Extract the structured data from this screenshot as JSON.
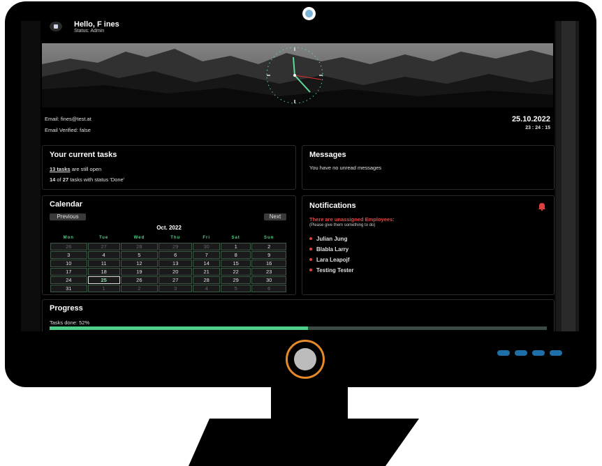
{
  "header": {
    "greeting": "Hello, F ines",
    "status": "Status: Admin"
  },
  "account": {
    "email": "Email: fines@test.at",
    "verified": "Email Verified: false",
    "date": "25.10.2022",
    "time": "23 : 24 : 15"
  },
  "tasks": {
    "title": "Your current tasks",
    "open_link": "13 tasks",
    "open_suffix": " are still open",
    "done_a": "14",
    "done_of": " of ",
    "done_b": "27",
    "done_suffix": " tasks with status 'Done'"
  },
  "messages": {
    "title": "Messages",
    "text": "You have no unread messages"
  },
  "calendar": {
    "title": "Calendar",
    "prev": "Previous",
    "next": "Next",
    "month": "Oct. 2022",
    "days": [
      "Mon",
      "Tue",
      "Wed",
      "Thu",
      "Fri",
      "Sat",
      "Sun"
    ],
    "weeks": [
      [
        "26",
        "27",
        "28",
        "29",
        "30",
        "1",
        "2"
      ],
      [
        "3",
        "4",
        "5",
        "6",
        "7",
        "8",
        "9"
      ],
      [
        "10",
        "11",
        "12",
        "13",
        "14",
        "15",
        "16"
      ],
      [
        "17",
        "18",
        "19",
        "20",
        "21",
        "22",
        "23"
      ],
      [
        "24",
        "25",
        "26",
        "27",
        "28",
        "29",
        "30"
      ],
      [
        "31",
        "1",
        "2",
        "3",
        "4",
        "5",
        "6"
      ]
    ],
    "today": "25"
  },
  "notifications": {
    "title": "Notifications",
    "alert": "There are unassigned Employees:",
    "hint": "(Please give them something to do)",
    "employees": [
      "Julian Jung",
      "Blabla Larry",
      "Lara Leapojf",
      "Testing Tester"
    ],
    "alert_color": "#e04848"
  },
  "progress": {
    "title": "Progress",
    "label": "Tasks done: 52%",
    "value": 0.52,
    "color": "#4fd08a"
  },
  "icons": {
    "avatar": "avatar-icon",
    "bell": "bell-icon",
    "webcam": "webcam-icon",
    "power": "power-button-icon"
  }
}
